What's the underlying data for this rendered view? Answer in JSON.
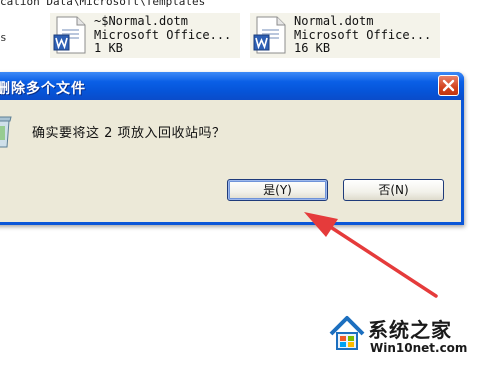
{
  "explorer": {
    "path_fragment": "cation Data\\Microsoft\\Templates",
    "left_edge_label": "s",
    "files": [
      {
        "name": "~$Normal.dotm",
        "type": "Microsoft Office...",
        "size": "1 KB",
        "icon": "word-template-icon"
      },
      {
        "name": "Normal.dotm",
        "type": "Microsoft Office...",
        "size": "16 KB",
        "icon": "word-template-icon"
      }
    ]
  },
  "dialog": {
    "title": "删除多个文件",
    "message": "确实要将这 2 项放入回收站吗？",
    "icon": "recycle-bin-icon",
    "close_icon": "close-icon",
    "buttons": {
      "yes": "是(Y)",
      "no": "否(N)"
    }
  },
  "watermark": {
    "brand": "系统之家",
    "domain": "Win10net.com",
    "icon": "house-logo-icon"
  },
  "colors": {
    "titlebar": "#0a5fe6",
    "dialog_face": "#ece9d8",
    "close_button": "#d3431f",
    "arrow": "#e53b3b"
  }
}
